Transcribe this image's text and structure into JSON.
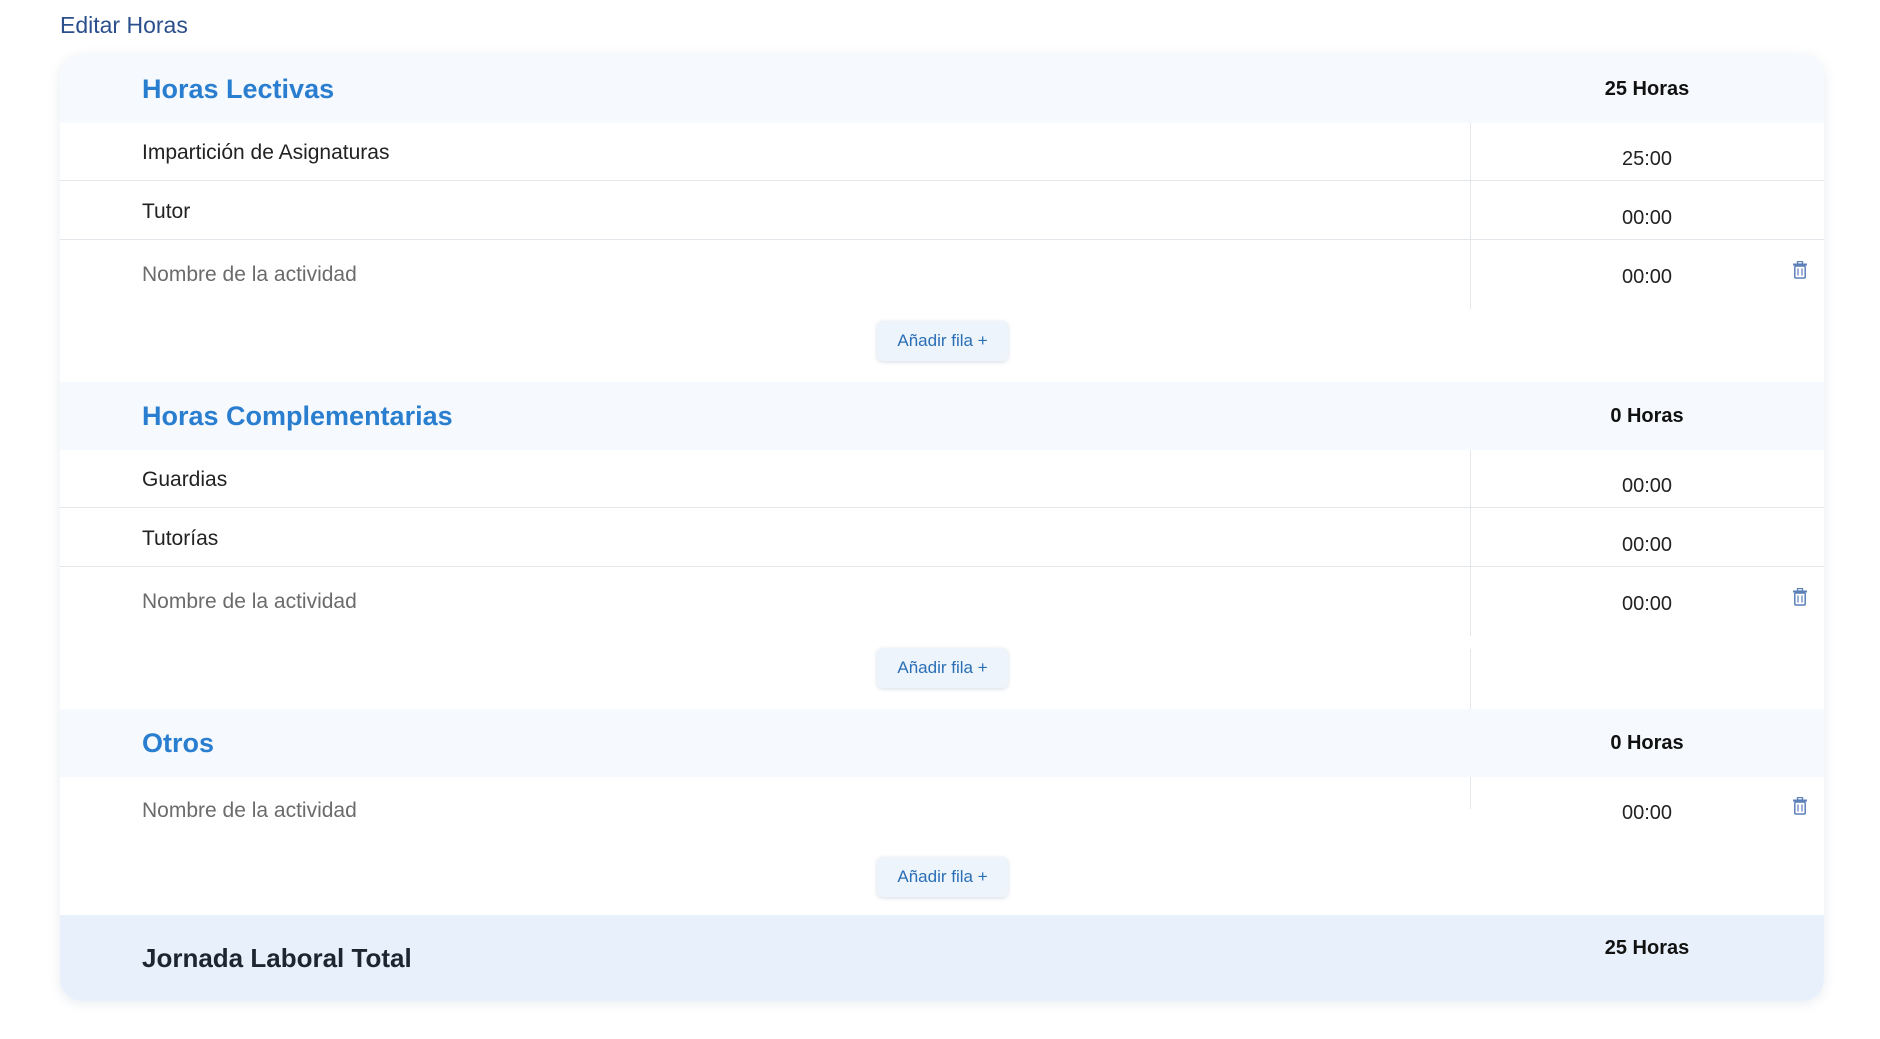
{
  "page_title": "Editar Horas",
  "sections": [
    {
      "title": "Horas Lectivas",
      "total": "25 Horas",
      "rows": [
        {
          "label": "Impartición de Asignaturas",
          "time": "25:00"
        },
        {
          "label": "Tutor",
          "time": "00:00"
        }
      ],
      "new_row": {
        "placeholder": "Nombre de la actividad",
        "time": "00:00"
      },
      "add_label": "Añadir fila +"
    },
    {
      "title": "Horas Complementarias",
      "total": "0 Horas",
      "rows": [
        {
          "label": "Guardias",
          "time": "00:00"
        },
        {
          "label": "Tutorías",
          "time": "00:00"
        }
      ],
      "new_row": {
        "placeholder": "Nombre de la actividad",
        "time": "00:00"
      },
      "add_label": "Añadir fila +"
    },
    {
      "title": "Otros",
      "total": "0 Horas",
      "rows": [],
      "new_row": {
        "placeholder": "Nombre de la actividad",
        "time": "00:00"
      },
      "add_label": "Añadir fila +"
    }
  ],
  "footer": {
    "label": "Jornada Laboral Total",
    "total": "25 Horas"
  },
  "colors": {
    "accent": "#2a7ed0",
    "title": "#2b4f8c",
    "icon": "#5b7fb8"
  },
  "icons": {
    "delete": "trash-icon"
  }
}
